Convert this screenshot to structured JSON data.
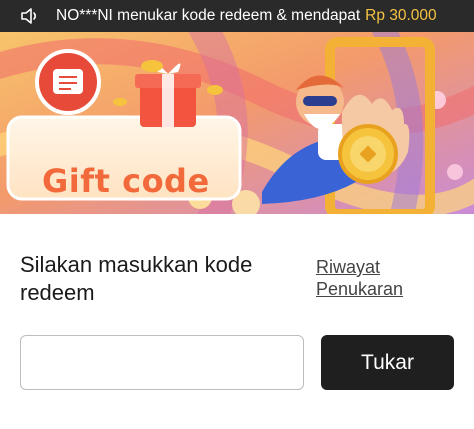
{
  "notice": {
    "icon": "speaker-icon",
    "text": "NO***NI menukar kode redeem & mendapat",
    "amount": "Rp 30.000",
    "amount_color": "#f4c244"
  },
  "banner": {
    "title": "Gift code",
    "illustration": "gift-box-and-character-with-coin"
  },
  "form": {
    "prompt": "Silakan masukkan kode redeem",
    "history_link": "Riwayat Penukaran",
    "input_value": "",
    "input_placeholder": "",
    "redeem_label": "Tukar"
  },
  "colors": {
    "accent": "#1f1f1f",
    "title": "#f26a3b",
    "notice_bg": "#2b2a2a"
  }
}
